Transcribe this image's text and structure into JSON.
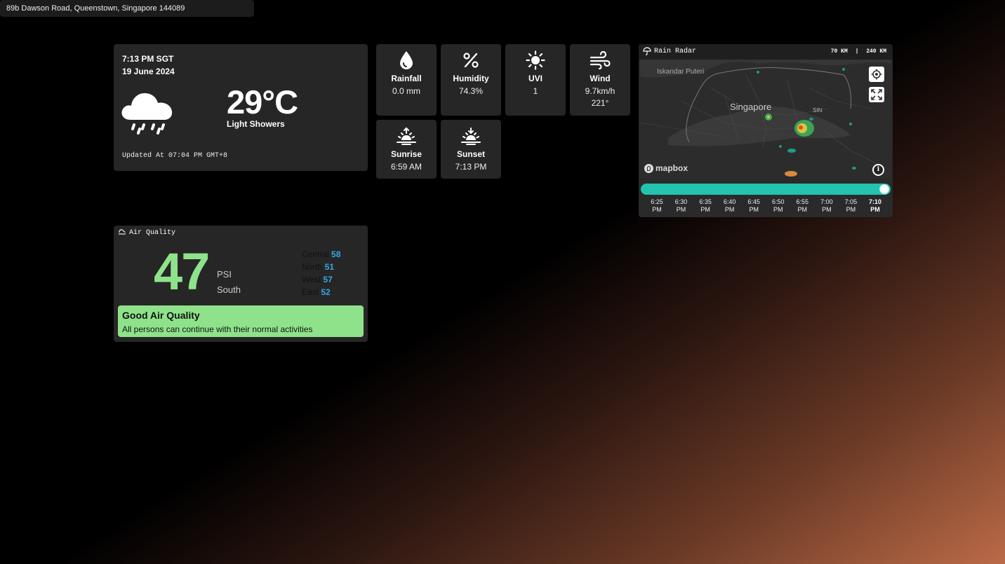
{
  "address": "89b Dawson Road, Queenstown, Singapore 144089",
  "weather": {
    "time": "7:13 PM SGT",
    "date": "19 June 2024",
    "temperature": "29°C",
    "condition": "Light Showers",
    "updated": "Updated At 07:04 PM GMT+8",
    "icon": "cloud-rain-icon"
  },
  "stats": {
    "rainfall": {
      "label": "Rainfall",
      "value": "0.0 mm",
      "icon": "droplet-icon"
    },
    "humidity": {
      "label": "Humidity",
      "value": "74.3%",
      "icon": "percent-icon"
    },
    "uvi": {
      "label": "UVI",
      "value": "1",
      "icon": "sun-icon"
    },
    "wind": {
      "label": "Wind",
      "value": "9.7km/h",
      "direction": "221°",
      "icon": "wind-icon"
    },
    "sunrise": {
      "label": "Sunrise",
      "value": "6:59 AM",
      "icon": "sunrise-icon"
    },
    "sunset": {
      "label": "Sunset",
      "value": "7:13 PM",
      "icon": "sunset-icon"
    }
  },
  "radar": {
    "title": "Rain Radar",
    "range_a": "70 KM",
    "separator": "|",
    "range_b": "240 KM",
    "map_labels": {
      "iskandar": "Iskandar Puteri",
      "singapore": "Singapore",
      "sin": "SIN",
      "mapbox": "mapbox"
    },
    "timeline_position": 1.0,
    "times": [
      {
        "t": "6:25",
        "p": "PM"
      },
      {
        "t": "6:30",
        "p": "PM"
      },
      {
        "t": "6:35",
        "p": "PM"
      },
      {
        "t": "6:40",
        "p": "PM"
      },
      {
        "t": "6:45",
        "p": "PM"
      },
      {
        "t": "6:50",
        "p": "PM"
      },
      {
        "t": "6:55",
        "p": "PM"
      },
      {
        "t": "7:00",
        "p": "PM"
      },
      {
        "t": "7:05",
        "p": "PM"
      },
      {
        "t": "7:10",
        "p": "PM"
      }
    ],
    "active_time": "7:10 PM"
  },
  "air_quality": {
    "title": "Air Quality",
    "psi": "47",
    "unit": "PSI",
    "region": "South",
    "regions": [
      {
        "name": "Central",
        "value": "58"
      },
      {
        "name": "North",
        "value": "51"
      },
      {
        "name": "West",
        "value": "57"
      },
      {
        "name": "East",
        "value": "52"
      }
    ],
    "status": "Good Air Quality",
    "advice": "All persons can continue with their normal activities",
    "status_color": "#8ee38a",
    "region_value_color": "#37a7e8"
  },
  "colors": {
    "accent": "#23c3b0",
    "card": "#262626"
  }
}
